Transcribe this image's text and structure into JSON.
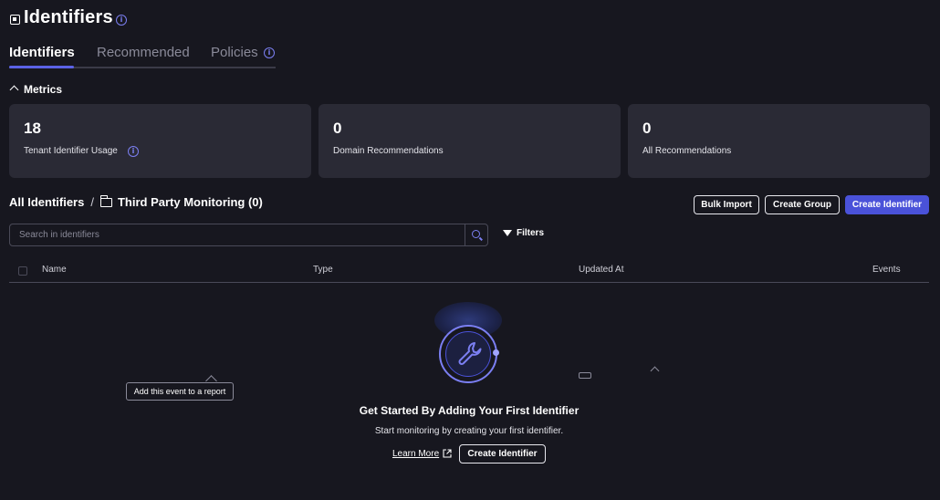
{
  "header": {
    "title": "Identifiers",
    "title_icon": "page-icon",
    "info_icon": "info-icon"
  },
  "tabs": [
    {
      "label": "Identifiers",
      "active": true
    },
    {
      "label": "Recommended",
      "active": false
    },
    {
      "label": "Policies",
      "active": false,
      "icon": "info-icon"
    }
  ],
  "metrics": {
    "title": "Metrics",
    "cards": [
      {
        "value": "18",
        "label": "Tenant Identifier Usage",
        "has_info": true
      },
      {
        "value": "0",
        "label": "Domain Recommendations"
      },
      {
        "value": "0",
        "label": "All Recommendations"
      }
    ]
  },
  "breadcrumb": {
    "root": "All Identifiers",
    "separator": "/",
    "current": "Third Party Monitoring (0)"
  },
  "actions": {
    "bulk_import": "Bulk Import",
    "create_group": "Create Group",
    "create_identifier": "Create Identifier"
  },
  "search": {
    "placeholder": "Search in identifiers",
    "filters_label": "Filters"
  },
  "table": {
    "columns": [
      "Name",
      "Type",
      "Updated At",
      "Events"
    ]
  },
  "tooltip": {
    "text": "Add this event to a report"
  },
  "empty_state": {
    "title": "Get Started By Adding Your First Identifier",
    "subtitle": "Start monitoring by creating your first identifier.",
    "learn_more": "Learn More",
    "button": "Create Identifier",
    "icon": "wrench-icon"
  },
  "colors": {
    "background": "#17171f",
    "card": "#2a2a35",
    "accent": "#4a52d9",
    "accent_light": "#7b7ff2"
  }
}
